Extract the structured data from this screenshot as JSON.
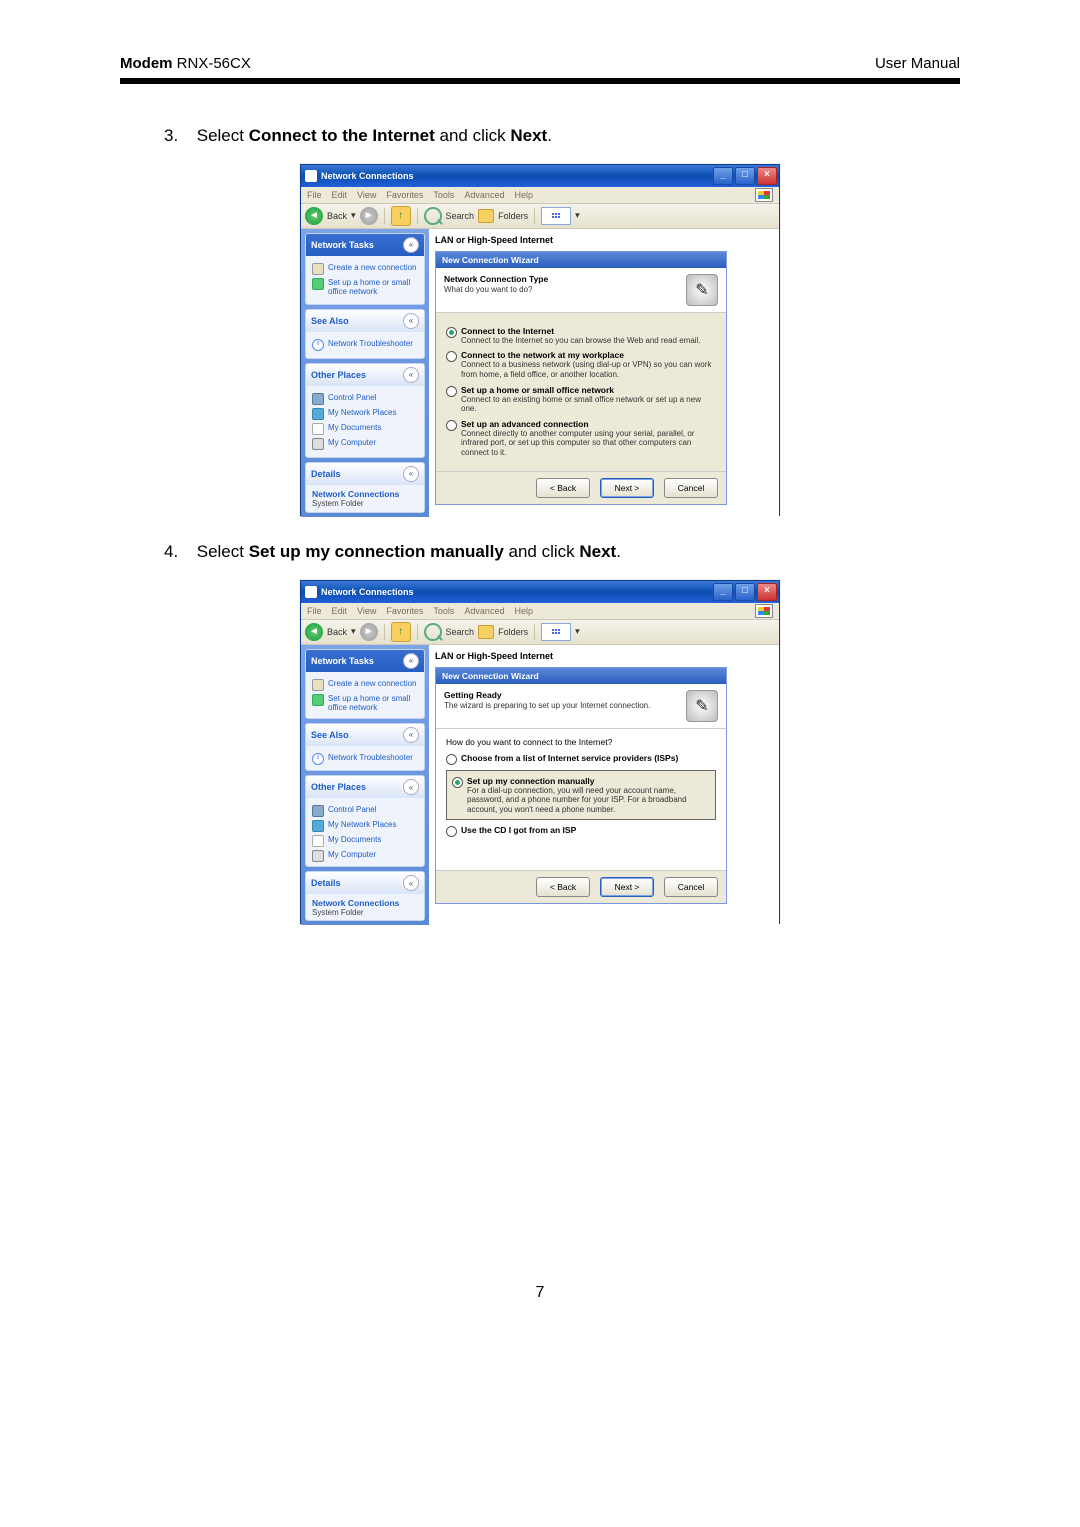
{
  "header": {
    "model_bold": "Modem",
    "model_rest": " RNX-56CX",
    "right": "User  Manual"
  },
  "steps": {
    "s3": {
      "num": "3.",
      "pre": "Select ",
      "bold1": "Connect to the Internet",
      "mid": " and click ",
      "bold2": "Next",
      "post": "."
    },
    "s4": {
      "num": "4.",
      "pre": "Select ",
      "bold1": "Set up my connection manually",
      "mid": " and click ",
      "bold2": "Next",
      "post": "."
    }
  },
  "win": {
    "title": "Network Connections",
    "menu": [
      "File",
      "Edit",
      "View",
      "Favorites",
      "Tools",
      "Advanced",
      "Help"
    ],
    "toolbar": {
      "back": "Back",
      "search": "Search",
      "folders": "Folders"
    },
    "content_header": "LAN or High-Speed Internet"
  },
  "sidebar": {
    "tasks": {
      "title": "Network Tasks",
      "items": [
        {
          "icon": "ico-dial",
          "label": "Create a new connection"
        },
        {
          "icon": "ico-net",
          "label": "Set up a home or small office network"
        }
      ]
    },
    "see_also": {
      "title": "See Also",
      "items": [
        {
          "icon": "ico-info",
          "label": "Network Troubleshooter"
        }
      ]
    },
    "other": {
      "title": "Other Places",
      "items": [
        {
          "icon": "ico-cp",
          "label": "Control Panel"
        },
        {
          "icon": "ico-mnp",
          "label": "My Network Places"
        },
        {
          "icon": "ico-doc",
          "label": "My Documents"
        },
        {
          "icon": "ico-pc",
          "label": "My Computer"
        }
      ]
    },
    "details": {
      "title": "Details",
      "main": "Network Connections",
      "sub": "System Folder"
    }
  },
  "wizard1": {
    "title": "New Connection Wizard",
    "head_bold": "Network Connection Type",
    "head_sub": "What do you want to do?",
    "options": [
      {
        "sel": true,
        "title": "Connect to the Internet",
        "desc": "Connect to the Internet so you can browse the Web and read email."
      },
      {
        "sel": false,
        "title": "Connect to the network at my workplace",
        "desc": "Connect to a business network (using dial-up or VPN) so you can work from home, a field office, or another location."
      },
      {
        "sel": false,
        "title": "Set up a home or small office network",
        "desc": "Connect to an existing home or small office network or set up a new one."
      },
      {
        "sel": false,
        "title": "Set up an advanced connection",
        "desc": "Connect directly to another computer using your serial, parallel, or infrared port, or set up this computer so that other computers can connect to it."
      }
    ],
    "buttons": {
      "back": "< Back",
      "next": "Next >",
      "cancel": "Cancel"
    }
  },
  "wizard2": {
    "title": "New Connection Wizard",
    "head_bold": "Getting Ready",
    "head_sub": "The wizard is preparing to set up your Internet connection.",
    "question": "How do you want to connect to the Internet?",
    "opt_top": {
      "sel": false,
      "title": "Choose from a list of Internet service providers (ISPs)"
    },
    "opt_mid": {
      "sel": true,
      "title": "Set up my connection manually",
      "desc": "For a dial-up connection, you will need your account name, password, and a phone number for your ISP. For a broadband account, you won't need a phone number."
    },
    "opt_bot": {
      "sel": false,
      "title": "Use the CD I got from an ISP"
    },
    "buttons": {
      "back": "< Back",
      "next": "Next >",
      "cancel": "Cancel"
    }
  },
  "pagenum": "7"
}
